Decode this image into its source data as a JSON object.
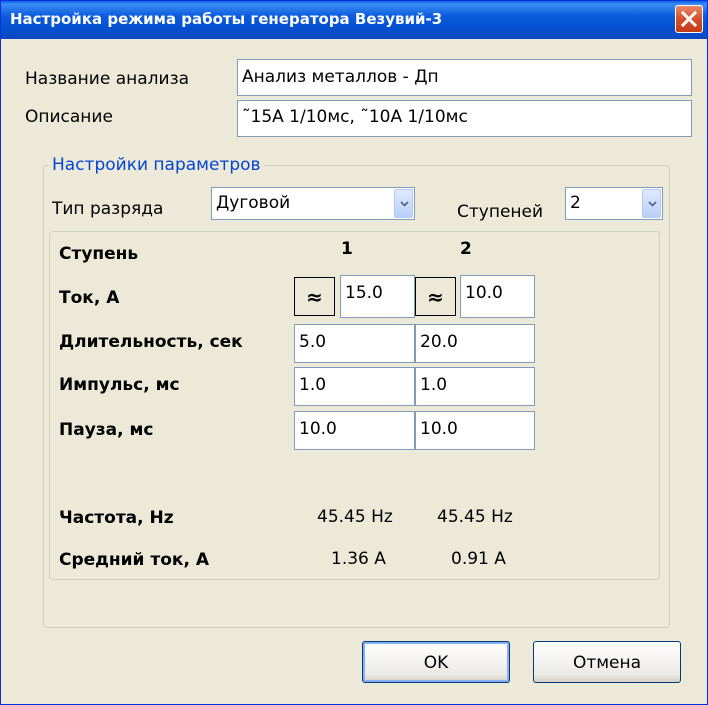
{
  "window": {
    "title": "Настройка режима работы генератора Везувий-3"
  },
  "form": {
    "name_label": "Название анализа",
    "name_value": "Анализ металлов - Дп",
    "desc_label": "Описание",
    "desc_value": "˜15A 1/10мс, ˜10A 1/10мс"
  },
  "params": {
    "group_title": "Настройки параметров",
    "discharge_label": "Тип разряда",
    "discharge_value": "Дуговой",
    "steps_label": "Ступеней",
    "steps_value": "2"
  },
  "table": {
    "stage_label": "Ступень",
    "col1": "1",
    "col2": "2",
    "current_label": "Ток, А",
    "current_mode_symbol": "≈",
    "current": [
      "15.0",
      "10.0"
    ],
    "duration_label": "Длительность, сек",
    "duration": [
      "5.0",
      "20.0"
    ],
    "impulse_label": "Импульс, мс",
    "impulse": [
      "1.0",
      "1.0"
    ],
    "pause_label": "Пауза, мс",
    "pause": [
      "10.0",
      "10.0"
    ],
    "freq_label": "Частота, Hz",
    "freq": [
      "45.45 Hz",
      "45.45 Hz"
    ],
    "avg_label": "Средний ток, А",
    "avg": [
      "1.36 A",
      "0.91 A"
    ]
  },
  "buttons": {
    "ok": "OK",
    "cancel": "Отмена"
  },
  "colors": {
    "titlebar": "#0a5bdc",
    "group_title": "#0046d5",
    "close": "#d4502a"
  }
}
